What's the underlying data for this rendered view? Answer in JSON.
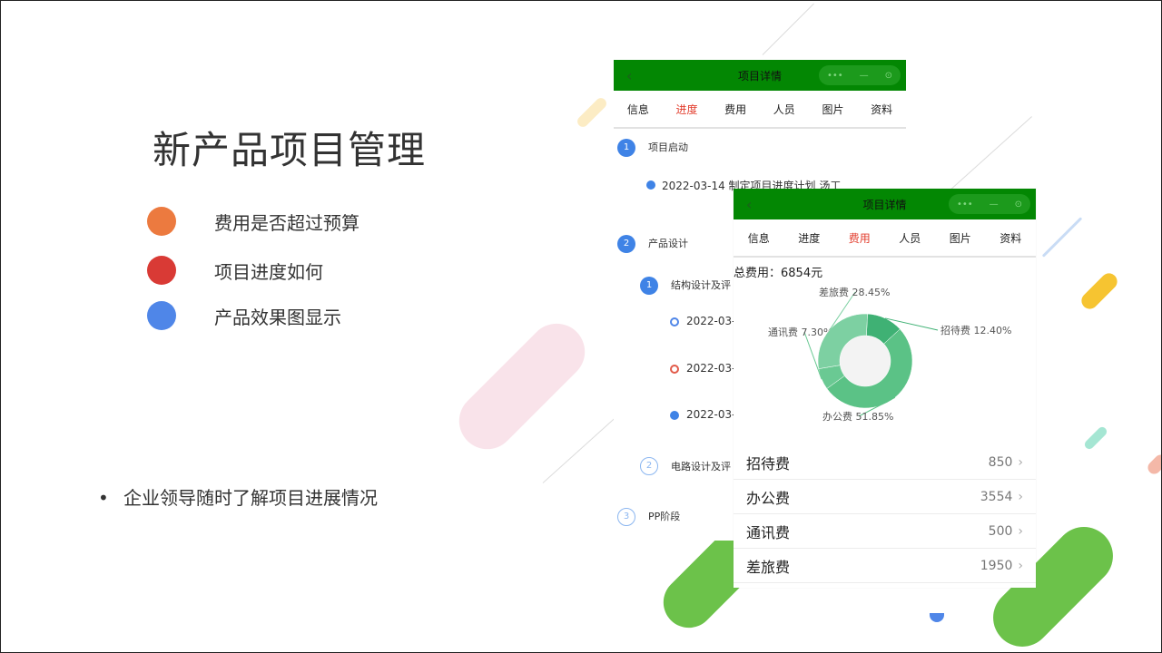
{
  "slide": {
    "title": "新产品项目管理",
    "bullets": [
      {
        "text": "费用是否超过预算",
        "color": "#ec7a3f"
      },
      {
        "text": "项目进度如何",
        "color": "#d93a35"
      },
      {
        "text": "产品效果图显示",
        "color": "#4f86e8"
      }
    ],
    "note_mark": "•",
    "note": "企业领导随时了解项目进展情况"
  },
  "phone_progress": {
    "title": "项目详情",
    "back_icon": "‹",
    "capsule": [
      "•••",
      "—",
      "⊙"
    ],
    "tabs": [
      "信息",
      "进度",
      "费用",
      "人员",
      "图片",
      "资料"
    ],
    "active_tab": 1,
    "stages": [
      {
        "num": "1",
        "label": "项目启动"
      },
      {
        "num": "2",
        "label": "产品设计"
      },
      {
        "num": "3",
        "label": "PP阶段"
      }
    ],
    "first_event": "2022-03-14 制定项目进度计划 汤工",
    "substeps": [
      {
        "num": "1",
        "label": "结构设计及评"
      },
      {
        "num": "2",
        "label": "电路设计及评"
      }
    ],
    "sub_events": [
      "2022-03-",
      "2022-03-",
      "2022-03-"
    ]
  },
  "phone_cost": {
    "title": "项目详情",
    "back_icon": "‹",
    "capsule": [
      "•••",
      "—",
      "⊙"
    ],
    "tabs": [
      "信息",
      "进度",
      "费用",
      "人员",
      "图片",
      "资料"
    ],
    "active_tab": 2,
    "total": "总费用：6854元",
    "items": [
      {
        "name": "招待费",
        "value": "850"
      },
      {
        "name": "办公费",
        "value": "3554"
      },
      {
        "name": "通讯费",
        "value": "500"
      },
      {
        "name": "差旅费",
        "value": "1950"
      }
    ],
    "chevron": "›"
  },
  "chart_data": {
    "type": "pie",
    "title": "",
    "slices": [
      {
        "name": "招待费",
        "value": 12.4,
        "label": "招待费 12.40%",
        "color": "#3fb174"
      },
      {
        "name": "办公费",
        "value": 51.85,
        "label": "办公费 51.85%",
        "color": "#5bc286"
      },
      {
        "name": "通讯费",
        "value": 7.3,
        "label": "通讯费 7.30%",
        "color": "#6ac993"
      },
      {
        "name": "差旅费",
        "value": 28.45,
        "label": "差旅费 28.45%",
        "color": "#7dd0a2"
      }
    ],
    "donut": true
  }
}
